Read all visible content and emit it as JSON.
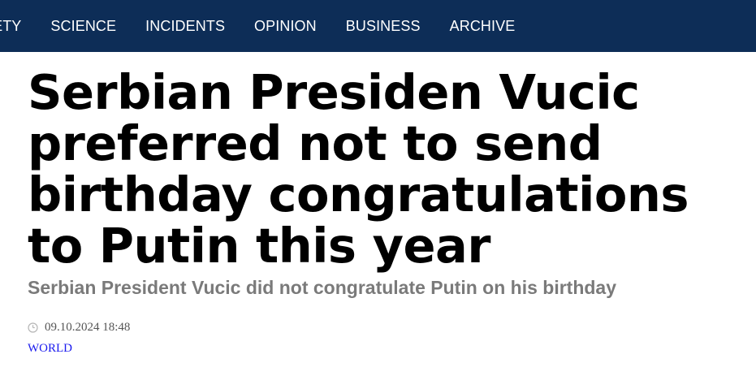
{
  "nav": {
    "items": [
      {
        "label": "IETY"
      },
      {
        "label": "SCIENCE"
      },
      {
        "label": "INCIDENTS"
      },
      {
        "label": "OPINION"
      },
      {
        "label": "BUSINESS"
      },
      {
        "label": "ARCHIVE"
      }
    ]
  },
  "article": {
    "headline": "Serbian Presiden Vucic preferred not to send birthday congratulations to Putin this year",
    "subheadline": "Serbian President Vucic did not congratulate Putin on his birthday",
    "datetime": "09.10.2024 18:48",
    "category": "WORLD",
    "clock_icon": "clock-icon"
  },
  "colors": {
    "nav_background": "#0d2d57",
    "subheadline": "#7a7a7a",
    "category_link": "#1a1aee"
  }
}
